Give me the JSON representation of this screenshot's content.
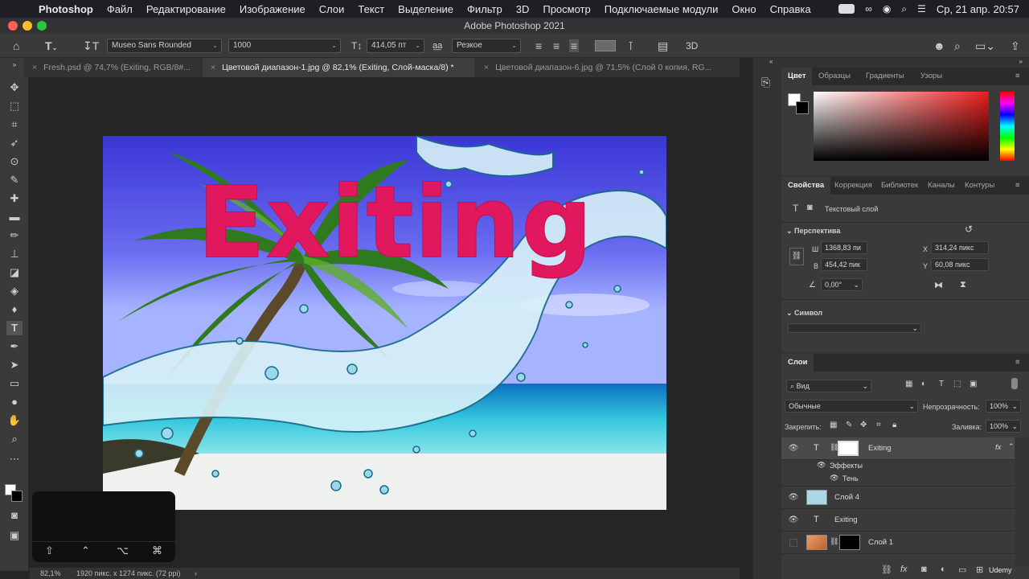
{
  "menubar": {
    "app_name": "Photoshop",
    "items": [
      "Файл",
      "Редактирование",
      "Изображение",
      "Слои",
      "Текст",
      "Выделение",
      "Фильтр",
      "3D",
      "Просмотр",
      "Подключаемые модули",
      "Окно",
      "Справка"
    ],
    "datetime": "Ср, 21 апр.  20:57"
  },
  "window_title": "Adobe Photoshop 2021",
  "options_bar": {
    "font_family": "Museo Sans Rounded",
    "font_style": "1000",
    "font_size": "414,05 пт",
    "antialias": "Резкое",
    "aa_label": "a͟a",
    "three_d_label": "3D"
  },
  "tabs": [
    {
      "label": "Fresh.psd @ 74,7% (Exiting, RGB/8#...",
      "active": false
    },
    {
      "label": "Цветовой диапазон-1.jpg @ 82,1% (Exiting, Слой-маска/8) *",
      "active": true
    },
    {
      "label": "Цветовой диапазон-6.jpg @ 71,5% (Слой 0 копия, RG...",
      "active": false
    }
  ],
  "canvas": {
    "overlay_text": "Exiting",
    "text_color": "#e2185e"
  },
  "statusbar": {
    "zoom": "82,1%",
    "doc_info": "1920 пикс. x 1274 пикс. (72 ppi)"
  },
  "key_overlay": {
    "keys": [
      "⇧",
      "⌃",
      "⌥",
      "⌘"
    ]
  },
  "color_panel": {
    "tabs": [
      "Цвет",
      "Образцы",
      "Градиенты",
      "Узоры"
    ]
  },
  "properties_panel": {
    "tabs": [
      "Свойства",
      "Коррекция",
      "Библиотек",
      "Каналы",
      "Контуры"
    ],
    "layer_kind": "Текстовый слой",
    "section_transform": "Перспектива",
    "w_label": "Ш",
    "w_value": "1368,83 пи",
    "h_label": "В",
    "h_value": "454,42 пик",
    "x_label": "X",
    "x_value": "314,24 пикс",
    "y_label": "Y",
    "y_value": "60,08 пикс",
    "angle_value": "0,00°",
    "section_symbol": "Символ"
  },
  "layers_panel": {
    "tab": "Слои",
    "filter_kind": "Вид",
    "blend_mode": "Обычные",
    "opacity_label": "Непрозрачность:",
    "opacity_value": "100%",
    "lock_label": "Закрепить:",
    "fill_label": "Заливка:",
    "fill_value": "100%",
    "layers": [
      {
        "name": "Exiting",
        "fx": "fx"
      },
      {
        "name": "Эффекты"
      },
      {
        "name": "Тень"
      },
      {
        "name": "Слой 4"
      },
      {
        "name": "Exiting"
      },
      {
        "name": "Слой 1"
      }
    ]
  },
  "watermark": "Udemy"
}
